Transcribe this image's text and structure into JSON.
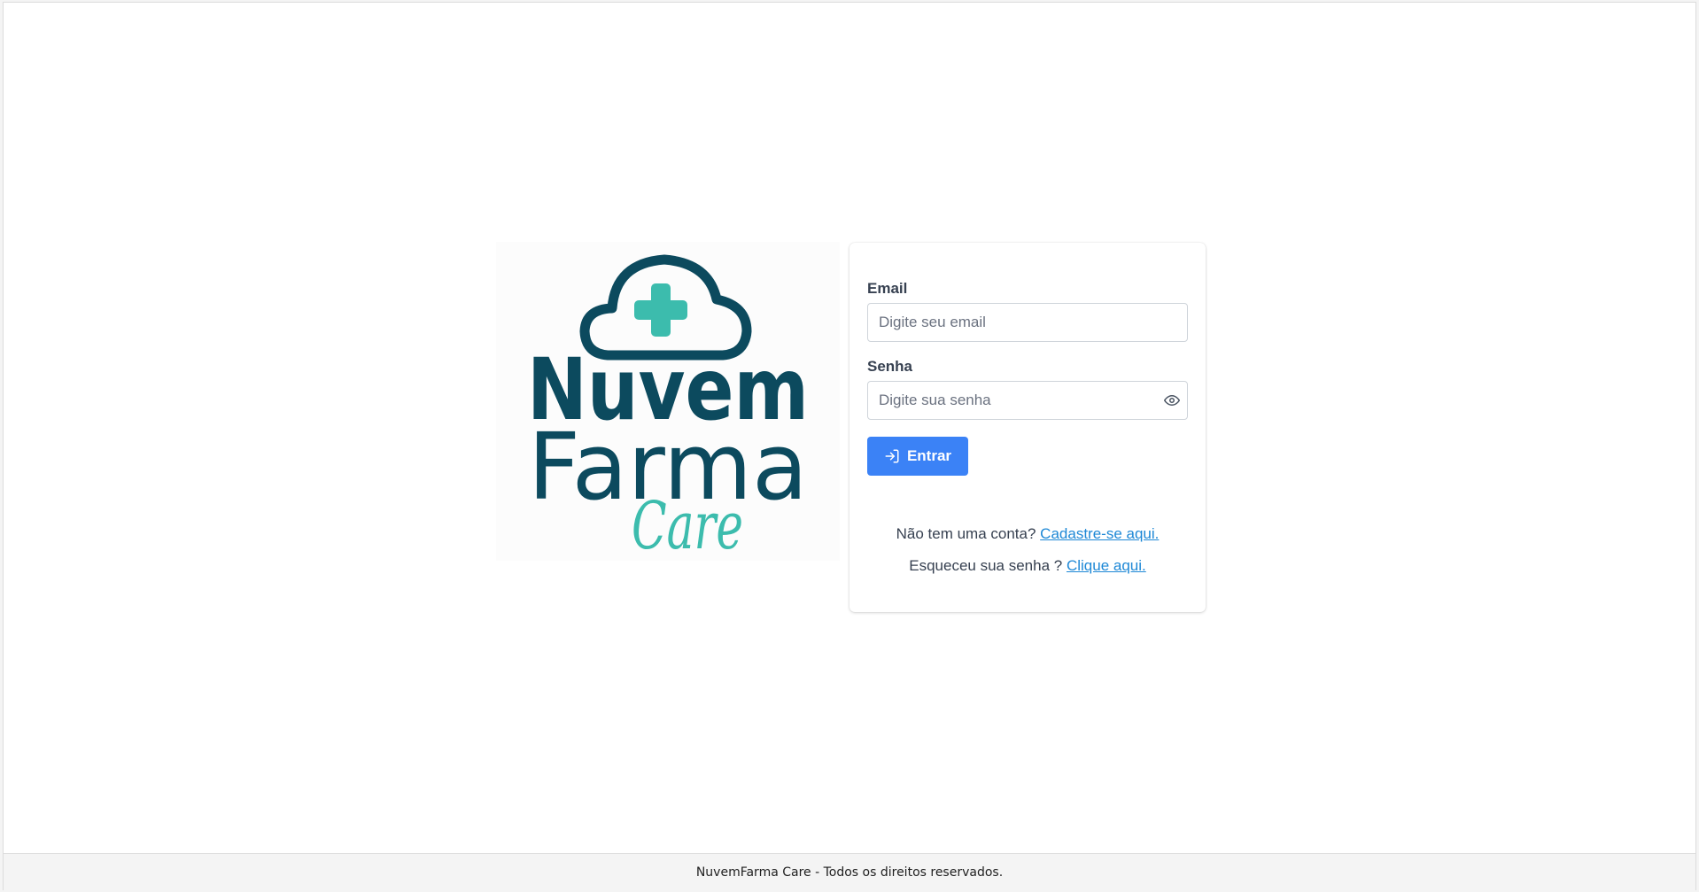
{
  "logo": {
    "line1": "Nuvem",
    "line2": "Farma",
    "line3": "Care",
    "colors": {
      "navy": "#0c4a5e",
      "teal": "#3cbcad"
    },
    "icon": "cloud-plus-icon"
  },
  "login": {
    "email": {
      "label": "Email",
      "placeholder": "Digite seu email",
      "value": ""
    },
    "password": {
      "label": "Senha",
      "placeholder": "Digite sua senha",
      "value": "",
      "toggle_icon": "eye-icon"
    },
    "submit": {
      "label": "Entrar",
      "icon": "sign-in-icon",
      "color": "#3b82f6"
    },
    "signup": {
      "text": "Não tem uma conta?",
      "link": "Cadastre-se aqui."
    },
    "forgot": {
      "text": "Esqueceu sua senha ?",
      "link": "Clique aqui."
    },
    "link_color": "#1e88d6"
  },
  "footer": {
    "text": "NuvemFarma Care - Todos os direitos reservados."
  }
}
